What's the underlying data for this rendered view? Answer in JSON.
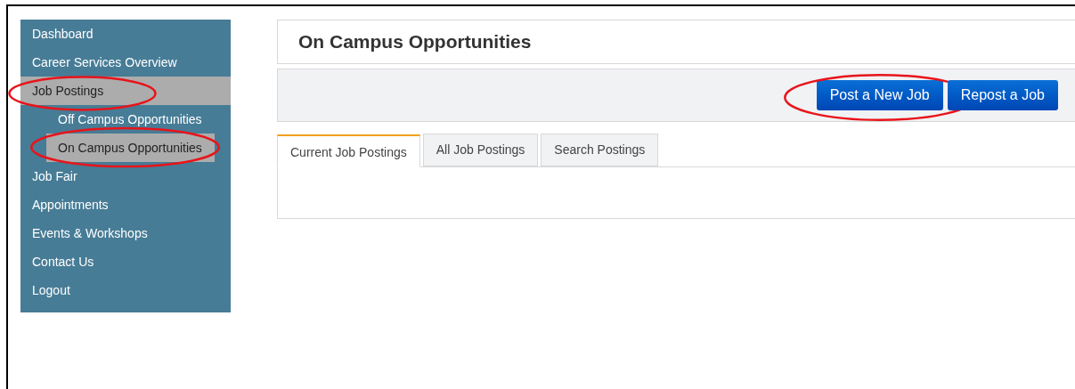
{
  "sidebar": {
    "items": [
      {
        "label": "Dashboard",
        "selected": false,
        "circled": false
      },
      {
        "label": "Career Services Overview",
        "selected": false,
        "circled": false
      },
      {
        "label": "Job Postings",
        "selected": true,
        "circled": true,
        "children": [
          {
            "label": "Off Campus Opportunities",
            "selected": false,
            "circled": false
          },
          {
            "label": "On Campus Opportunities",
            "selected": true,
            "circled": true
          }
        ]
      },
      {
        "label": "Job Fair",
        "selected": false,
        "circled": false
      },
      {
        "label": "Appointments",
        "selected": false,
        "circled": false
      },
      {
        "label": "Events & Workshops",
        "selected": false,
        "circled": false
      },
      {
        "label": "Contact Us",
        "selected": false,
        "circled": false
      },
      {
        "label": "Logout",
        "selected": false,
        "circled": false
      }
    ]
  },
  "page": {
    "title": "On Campus Opportunities"
  },
  "toolbar": {
    "buttons": [
      {
        "label": "Post a New Job",
        "circled": true
      },
      {
        "label": "Repost a Job",
        "circled": false
      }
    ]
  },
  "tabs": [
    {
      "label": "Current Job Postings",
      "selected": true
    },
    {
      "label": "All Job Postings",
      "selected": false
    },
    {
      "label": "Search Postings",
      "selected": false
    }
  ]
}
